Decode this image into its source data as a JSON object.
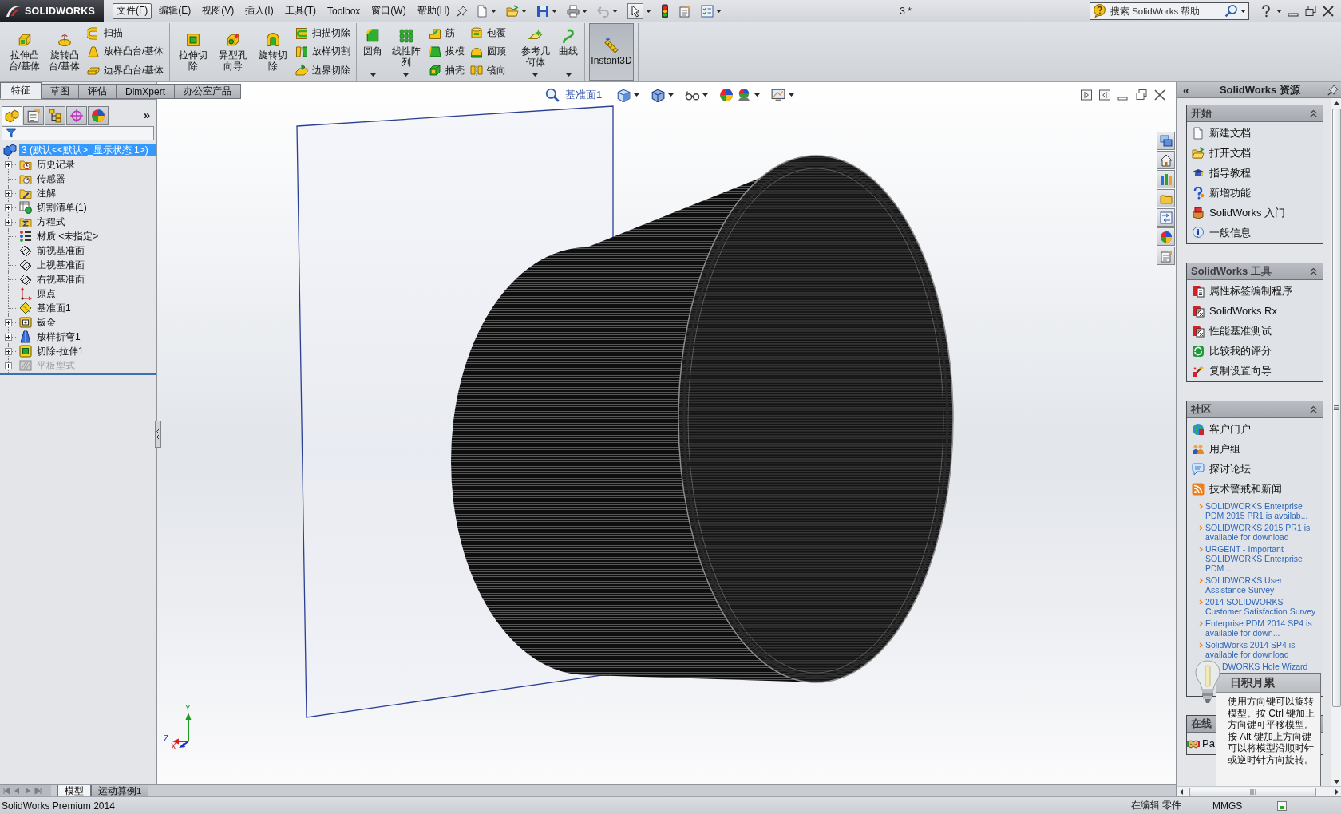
{
  "app_bar": {
    "logo_text": "SOLIDWORKS",
    "menu": [
      {
        "label": "文件(F)",
        "selected": true
      },
      {
        "label": "编辑(E)",
        "selected": false
      },
      {
        "label": "视图(V)",
        "selected": false
      },
      {
        "label": "插入(I)",
        "selected": false
      },
      {
        "label": "工具(T)",
        "selected": false
      },
      {
        "label": "Toolbox",
        "selected": false
      },
      {
        "label": "窗口(W)",
        "selected": false
      },
      {
        "label": "帮助(H)",
        "selected": false
      }
    ],
    "document_title": "3 *",
    "search": {
      "placeholder": "搜索 SolidWorks 帮助"
    }
  },
  "ribbon": {
    "groups": [
      {
        "large": [
          {
            "label": "拉伸凸台/基体",
            "kind": "extrude",
            "dropdown": false,
            "pressed": false
          },
          {
            "label": "旋转凸台/基体",
            "kind": "revolve",
            "dropdown": false,
            "pressed": false
          }
        ],
        "columns": [
          [
            {
              "label": "扫描",
              "kind": "sweep"
            },
            {
              "label": "放样凸台/基体",
              "kind": "loft"
            },
            {
              "label": "边界凸台/基体",
              "kind": "boundary"
            }
          ]
        ]
      },
      {
        "large": [
          {
            "label": "拉伸切除",
            "kind": "cutextrude",
            "dropdown": false,
            "pressed": false
          },
          {
            "label": "异型孔向导",
            "kind": "hole",
            "dropdown": false,
            "pressed": false
          },
          {
            "label": "旋转切除",
            "kind": "cutrevolve",
            "dropdown": false,
            "pressed": false
          }
        ],
        "columns": [
          [
            {
              "label": "扫描切除",
              "kind": "cutsweep"
            },
            {
              "label": "放样切割",
              "kind": "cutloft"
            },
            {
              "label": "边界切除",
              "kind": "cutboundary"
            }
          ]
        ]
      },
      {
        "large": [
          {
            "label": "圆角",
            "kind": "fillet",
            "dropdown": true,
            "pressed": false
          },
          {
            "label": "线性阵列",
            "kind": "pattern",
            "dropdown": true,
            "pressed": false
          }
        ],
        "columns": [
          [
            {
              "label": "筋",
              "kind": "rib"
            },
            {
              "label": "拔模",
              "kind": "draft"
            },
            {
              "label": "抽壳",
              "kind": "shell"
            }
          ],
          [
            {
              "label": "包覆",
              "kind": "wrap"
            },
            {
              "label": "圆顶",
              "kind": "dome"
            },
            {
              "label": "镜向",
              "kind": "mirror"
            }
          ]
        ]
      },
      {
        "large": [
          {
            "label": "参考几何体",
            "kind": "refgeometry",
            "dropdown": true,
            "pressed": false
          },
          {
            "label": "曲线",
            "kind": "curve",
            "dropdown": true,
            "pressed": false
          }
        ]
      },
      {
        "large": [
          {
            "label": "Instant3D",
            "kind": "instant3d",
            "dropdown": false,
            "pressed": true
          }
        ]
      }
    ]
  },
  "command_tabs": [
    {
      "label": "特征",
      "selected": true
    },
    {
      "label": "草图",
      "selected": false
    },
    {
      "label": "评估",
      "selected": false
    },
    {
      "label": "DimXpert",
      "selected": false
    },
    {
      "label": "办公室产品",
      "selected": false
    }
  ],
  "feature_manager": {
    "tabs": [
      {
        "kind": "features",
        "selected": true
      },
      {
        "kind": "properties",
        "selected": false
      },
      {
        "kind": "configurations",
        "selected": false
      },
      {
        "kind": "dimxpert",
        "selected": false
      },
      {
        "kind": "display",
        "selected": false
      }
    ],
    "more_glyph": "»",
    "tree": {
      "label": "3 (默认<<默认>_显示状态 1>)",
      "selected": true,
      "children": [
        {
          "label": "历史记录",
          "kind": "history",
          "expandable": true,
          "suppressed": false,
          "selected": false
        },
        {
          "label": "传感器",
          "kind": "sensor",
          "expandable": false,
          "suppressed": false,
          "selected": false
        },
        {
          "label": "注解",
          "kind": "annotation",
          "expandable": true,
          "suppressed": false,
          "selected": false
        },
        {
          "label": "切割清单(1)",
          "kind": "cutlist",
          "expandable": true,
          "suppressed": false,
          "selected": false
        },
        {
          "label": "方程式",
          "kind": "equation",
          "expandable": true,
          "suppressed": false,
          "selected": false
        },
        {
          "label": "材质 <未指定>",
          "kind": "material",
          "expandable": false,
          "suppressed": false,
          "selected": false
        },
        {
          "label": "前视基准面",
          "kind": "plane",
          "expandable": false,
          "suppressed": false,
          "selected": false
        },
        {
          "label": "上视基准面",
          "kind": "plane",
          "expandable": false,
          "suppressed": false,
          "selected": false
        },
        {
          "label": "右视基准面",
          "kind": "plane",
          "expandable": false,
          "suppressed": false,
          "selected": false
        },
        {
          "label": "原点",
          "kind": "origin",
          "expandable": false,
          "suppressed": false,
          "selected": false
        },
        {
          "label": "基准面1",
          "kind": "refplane",
          "expandable": false,
          "suppressed": false,
          "selected": false
        },
        {
          "label": "钣金",
          "kind": "sheetmetal",
          "expandable": true,
          "suppressed": false,
          "selected": false
        },
        {
          "label": "放样折弯1",
          "kind": "loftbend",
          "expandable": true,
          "suppressed": false,
          "selected": false
        },
        {
          "label": "切除-拉伸1",
          "kind": "cut",
          "expandable": true,
          "suppressed": false,
          "selected": false
        },
        {
          "label": "平板型式",
          "kind": "flat",
          "expandable": true,
          "suppressed": true,
          "selected": false
        }
      ]
    }
  },
  "graphics": {
    "plane_label": "基准面1",
    "triad": [
      {
        "label": "Y",
        "color": "#1e9a1e"
      },
      {
        "label": "X",
        "color": "#d81e1e"
      },
      {
        "label": "Z",
        "color": "#1e2ec8"
      }
    ]
  },
  "model_tabs": [
    {
      "label": "模型",
      "selected": true
    },
    {
      "label": "运动算例1",
      "selected": false
    }
  ],
  "resources": {
    "collapse_glyph": "«",
    "title": "SolidWorks 资源",
    "sections": [
      {
        "title": "开始",
        "items": [
          {
            "label": "新建文档",
            "kind": "newdoc"
          },
          {
            "label": "打开文档",
            "kind": "open"
          },
          {
            "label": "指导教程",
            "kind": "tutorial"
          },
          {
            "label": "新增功能",
            "kind": "whatsnew"
          },
          {
            "label": "SolidWorks 入门",
            "kind": "intro"
          },
          {
            "label": "一般信息",
            "kind": "info"
          }
        ]
      },
      {
        "title": "SolidWorks 工具",
        "items": [
          {
            "label": "属性标签编制程序",
            "kind": "property"
          },
          {
            "label": "SolidWorks Rx",
            "kind": "rx"
          },
          {
            "label": "性能基准测试",
            "kind": "benchmark"
          },
          {
            "label": "比较我的评分",
            "kind": "compare"
          },
          {
            "label": "复制设置向导",
            "kind": "copywizard"
          }
        ]
      },
      {
        "title": "社区",
        "items": [
          {
            "label": "客户门户",
            "kind": "portal"
          },
          {
            "label": "用户组",
            "kind": "usergroup"
          },
          {
            "label": "探讨论坛",
            "kind": "forum"
          },
          {
            "label": "技术警戒和新闻",
            "kind": "rss"
          }
        ],
        "news": [
          {
            "text": "SOLIDWORKS Enterprise PDM 2015 PR1 is availab...",
            "bullet": true
          },
          {
            "text": "SOLIDWORKS 2015 PR1 is available for download",
            "bullet": true
          },
          {
            "text": "URGENT - Important SOLIDWORKS Enterprise PDM ...",
            "bullet": true
          },
          {
            "text": "SOLIDWORKS User Assistance Survey",
            "bullet": true
          },
          {
            "text": "2014 SOLIDWORKS Customer Satisfaction Survey",
            "bullet": true
          },
          {
            "text": "Enterprise PDM 2014 SP4 is available for down...",
            "bullet": true
          },
          {
            "text": "SolidWorks 2014 SP4 is available for download",
            "bullet": true
          },
          {
            "text": "DWORKS Hole Wizard",
            "bullet": false
          }
        ]
      }
    ],
    "covered_section": {
      "title": "在线",
      "items": [
        {
          "label": "Pa",
          "kind": "partner"
        }
      ]
    },
    "tip": {
      "title": "日积月累",
      "text": "使用方向键可以旋转模型。按 Ctrl 键加上方向键可平移模型。按 Alt 键加上方向键可以将模型沿顺时针或逆时针方向旋转。"
    }
  },
  "status_bar": {
    "product": "SolidWorks Premium 2014",
    "mode": "在编辑 零件",
    "units": "MMGS"
  }
}
